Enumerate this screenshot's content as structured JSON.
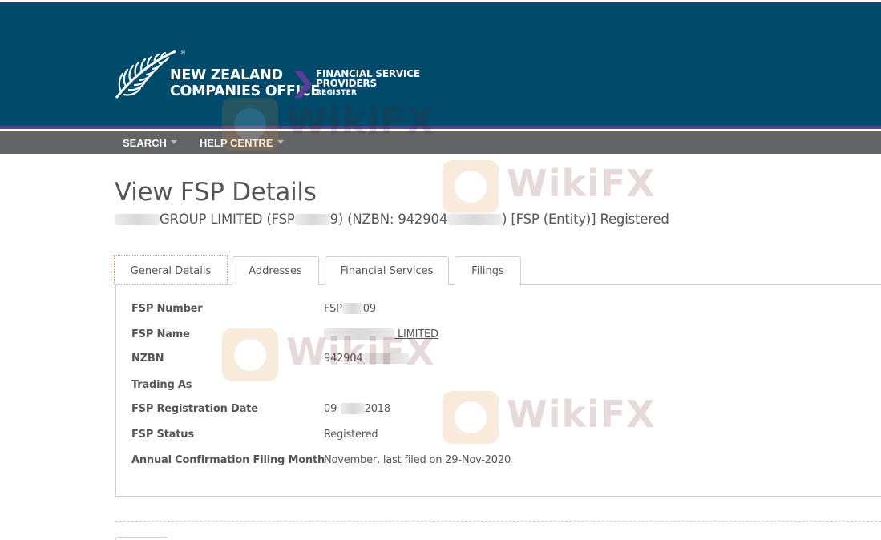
{
  "branding": {
    "org_line1": "NEW ZEALAND",
    "org_line2": "COMPANIES OFFICE",
    "register_line1": "FINANCIAL SERVICE",
    "register_line2": "PROVIDERS",
    "register_line3": "REGISTER",
    "trademark": "®"
  },
  "nav": {
    "search": "SEARCH",
    "help": "HELP CENTRE"
  },
  "page": {
    "title": "View FSP Details",
    "entity_part1": "GROUP LIMITED (FSP",
    "entity_part2": "9) (NZBN: 942904",
    "entity_part3": ") [FSP (Entity)] Registered"
  },
  "tabs": [
    {
      "label": "General Details",
      "active": true
    },
    {
      "label": "Addresses",
      "active": false
    },
    {
      "label": "Financial Services",
      "active": false
    },
    {
      "label": "Filings",
      "active": false
    }
  ],
  "details": {
    "fsp_number": {
      "label": "FSP Number",
      "value_prefix": "FSP",
      "value_suffix": "09"
    },
    "fsp_name": {
      "label": "FSP Name",
      "value_suffix": "LIMITED"
    },
    "nzbn": {
      "label": "NZBN",
      "value_prefix": "942904"
    },
    "trading_as": {
      "label": "Trading As",
      "value": ""
    },
    "registration_date": {
      "label": "FSP Registration Date",
      "value_prefix": "09-",
      "value_suffix": "2018"
    },
    "status": {
      "label": "FSP Status",
      "value": "Registered"
    },
    "annual_filing": {
      "label": "Annual Confirmation Filing Month",
      "value": "November, last filed on 29-Nov-2020"
    }
  },
  "watermark": {
    "text": "WikiFX"
  },
  "colors": {
    "header_bg": "#004b6b",
    "nav_bg": "#636466",
    "accent_chevron": "#5b3d9a",
    "text": "#555555"
  }
}
